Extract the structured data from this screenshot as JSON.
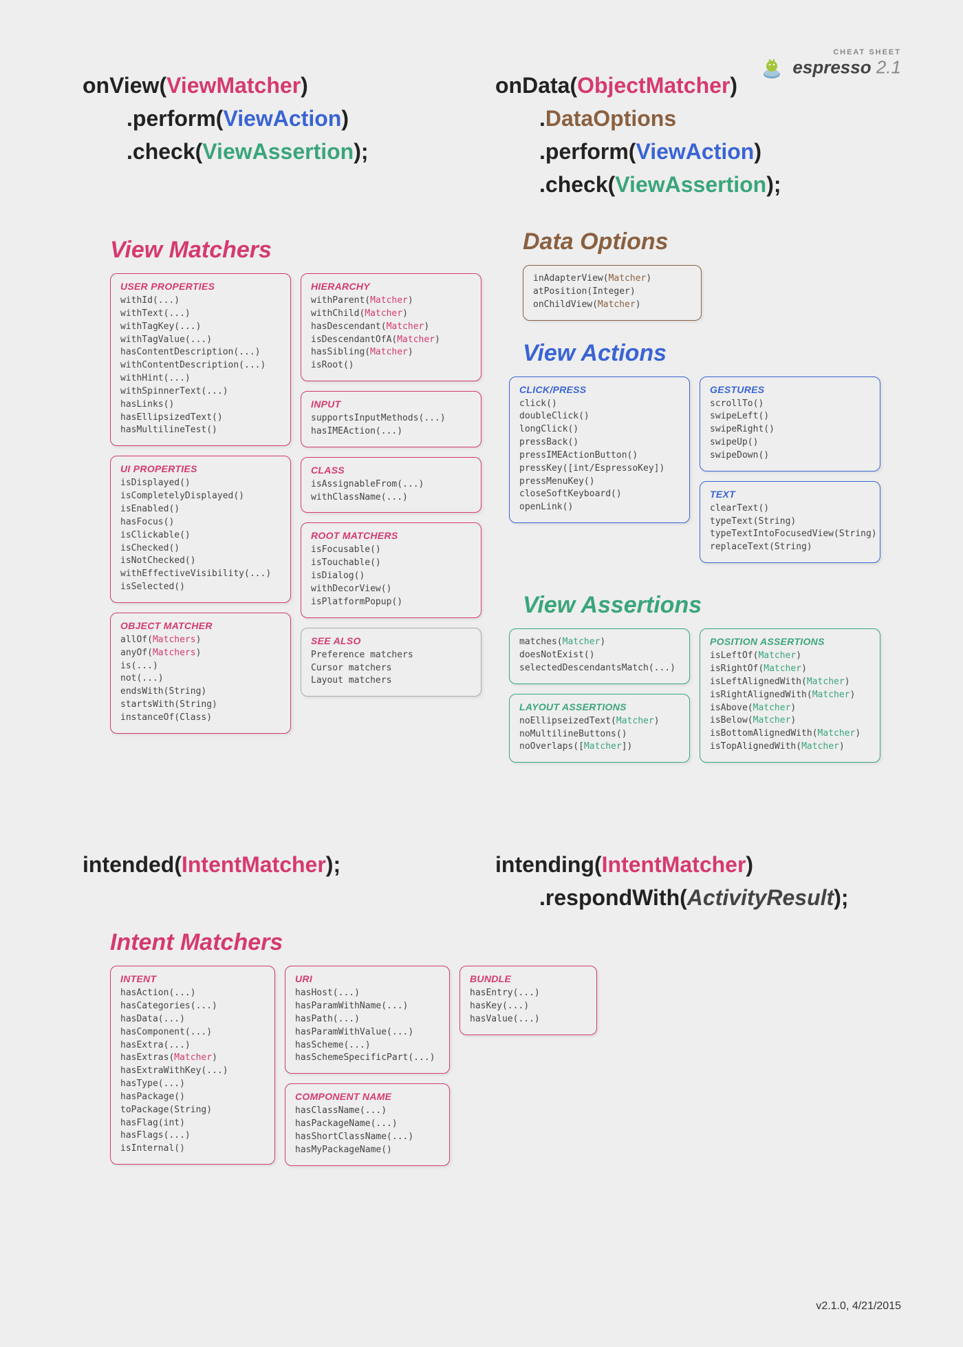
{
  "logo": {
    "tag": "CHEAT SHEET",
    "name": "espresso",
    "version": "2.1"
  },
  "footer": "v2.1.0, 4/21/2015",
  "api": {
    "onView": {
      "l1": {
        "fn": "onView",
        "arg": "ViewMatcher"
      },
      "l2": {
        "fn": ".perform",
        "arg": "ViewAction"
      },
      "l3": {
        "fn": ".check",
        "arg": "ViewAssertion",
        "tail": ";"
      }
    },
    "onData": {
      "l1": {
        "fn": "onData",
        "arg": "ObjectMatcher"
      },
      "l2": {
        "fn": ".",
        "arg": "DataOptions"
      },
      "l3": {
        "fn": ".perform",
        "arg": "ViewAction"
      },
      "l4": {
        "fn": ".check",
        "arg": "ViewAssertion",
        "tail": ";"
      }
    },
    "intended": {
      "fn": "intended",
      "arg": "IntentMatcher",
      "tail": ";"
    },
    "intending": {
      "l1": {
        "fn": "intending",
        "arg": "IntentMatcher"
      },
      "l2": {
        "fn": ".respondWith",
        "arg": "ActivityResult",
        "tail": ";"
      }
    }
  },
  "sections": {
    "viewMatchers": "View Matchers",
    "dataOptions": "Data Options",
    "viewActions": "View Actions",
    "viewAssertions": "View Assertions",
    "intentMatchers": "Intent Matchers"
  },
  "cards": {
    "userProps": {
      "title": "USER PROPERTIES",
      "lines": [
        "withId(...)",
        "withText(...)",
        "withTagKey(...)",
        "withTagValue(...)",
        "hasContentDescription(...)",
        "withContentDescription(...)",
        "withHint(...)",
        "withSpinnerText(...)",
        "hasLinks()",
        "hasEllipsizedText()",
        "hasMultilineTest()"
      ]
    },
    "uiProps": {
      "title": "UI PROPERTIES",
      "lines": [
        "isDisplayed()",
        "isCompletelyDisplayed()",
        "isEnabled()",
        "hasFocus()",
        "isClickable()",
        "isChecked()",
        "isNotChecked()",
        "withEffectiveVisibility(...)",
        "isSelected()"
      ]
    },
    "objectMatcher": {
      "title": "OBJECT MATCHER",
      "lines": [
        "allOf(<m>Matchers</m>)",
        "anyOf(<m>Matchers</m>)",
        "is(...)",
        "not(...)",
        "endsWith(String)",
        "startsWith(String)",
        "instanceOf(Class)"
      ]
    },
    "hierarchy": {
      "title": "HIERARCHY",
      "lines": [
        "withParent(<m>Matcher</m>)",
        "withChild(<m>Matcher</m>)",
        "hasDescendant(<m>Matcher</m>)",
        "isDescendantOfA(<m>Matcher</m>)",
        "hasSibling(<m>Matcher</m>)",
        "isRoot()"
      ]
    },
    "input": {
      "title": "INPUT",
      "lines": [
        "supportsInputMethods(...)",
        "hasIMEAction(...)"
      ]
    },
    "klass": {
      "title": "CLASS",
      "lines": [
        "isAssignableFrom(...)",
        "withClassName(...)"
      ]
    },
    "rootMatchers": {
      "title": "ROOT MATCHERS",
      "lines": [
        "isFocusable()",
        "isTouchable()",
        "isDialog()",
        "withDecorView()",
        "isPlatformPopup()"
      ]
    },
    "seeAlso": {
      "title": "SEE ALSO",
      "lines": [
        "Preference matchers",
        "Cursor matchers",
        "Layout matchers"
      ]
    },
    "dataOptions": {
      "lines": [
        "inAdapterView(<m>Matcher</m>)",
        "atPosition(Integer)",
        "onChildView(<m>Matcher</m>)"
      ]
    },
    "clickPress": {
      "title": "CLICK/PRESS",
      "lines": [
        "click()",
        "doubleClick()",
        "longClick()",
        "pressBack()",
        "pressIMEActionButton()",
        "pressKey([int/EspressoKey])",
        "pressMenuKey()",
        "closeSoftKeyboard()",
        "openLink()"
      ]
    },
    "gestures": {
      "title": "GESTURES",
      "lines": [
        "scrollTo()",
        "swipeLeft()",
        "swipeRight()",
        "swipeUp()",
        "swipeDown()"
      ]
    },
    "text": {
      "title": "TEXT",
      "lines": [
        "clearText()",
        "typeText(String)",
        "typeTextIntoFocusedView(String)",
        "replaceText(String)"
      ]
    },
    "assert1": {
      "lines": [
        "matches(<m>Matcher</m>)",
        "doesNotExist()",
        "selectedDescendantsMatch(...)"
      ]
    },
    "positionAssert": {
      "title": "POSITION ASSERTIONS",
      "lines": [
        "isLeftOf(<m>Matcher</m>)",
        "isRightOf(<m>Matcher</m>)",
        "isLeftAlignedWith(<m>Matcher</m>)",
        "isRightAlignedWith(<m>Matcher</m>)",
        "isAbove(<m>Matcher</m>)",
        "isBelow(<m>Matcher</m>)",
        "isBottomAlignedWith(<m>Matcher</m>)",
        "isTopAlignedWith(<m>Matcher</m>)"
      ]
    },
    "layoutAssert": {
      "title": "LAYOUT ASSERTIONS",
      "lines": [
        "noEllipseizedText(<m>Matcher</m>)",
        "noMultilineButtons()",
        "noOverlaps([<m>Matcher</m>])"
      ]
    },
    "intent": {
      "title": "INTENT",
      "lines": [
        "hasAction(...)",
        "hasCategories(...)",
        "hasData(...)",
        "hasComponent(...)",
        "hasExtra(...)",
        "hasExtras(<m>Matcher</m>)",
        "hasExtraWithKey(...)",
        "hasType(...)",
        "hasPackage()",
        "toPackage(String)",
        "hasFlag(int)",
        "hasFlags(...)",
        "isInternal()"
      ]
    },
    "uri": {
      "title": "URI",
      "lines": [
        "hasHost(...)",
        "hasParamWithName(...)",
        "hasPath(...)",
        "hasParamWithValue(...)",
        "hasScheme(...)",
        "hasSchemeSpecificPart(...)"
      ]
    },
    "componentName": {
      "title": "COMPONENT NAME",
      "lines": [
        "hasClassName(...)",
        "hasPackageName(...)",
        "hasShortClassName(...)",
        "hasMyPackageName()"
      ]
    },
    "bundle": {
      "title": "BUNDLE",
      "lines": [
        "hasEntry(...)",
        "hasKey(...)",
        "hasValue(...)"
      ]
    }
  }
}
